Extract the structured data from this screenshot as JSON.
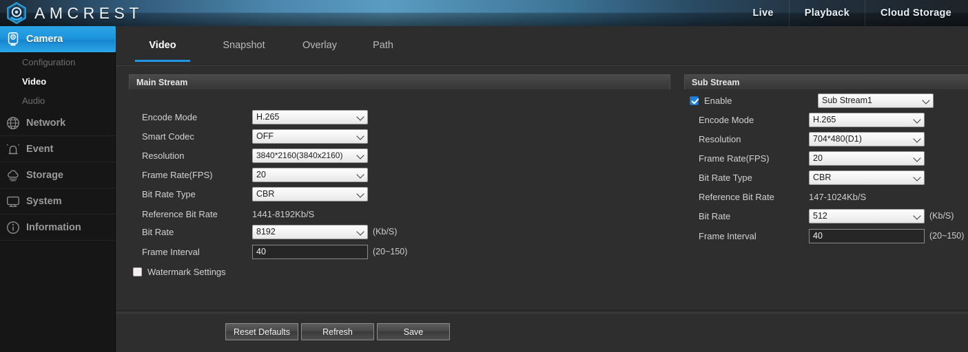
{
  "header": {
    "brand": "AMCREST",
    "logo_icon": "amcrest-hex-lens-logo",
    "nav": [
      {
        "label": "Live"
      },
      {
        "label": "Playback"
      },
      {
        "label": "Cloud Storage"
      }
    ],
    "accent_color": "#2196e6",
    "gradient_from": "#5b9cc2",
    "gradient_to": "#1d2329"
  },
  "sidebar": {
    "groups": [
      {
        "label": "Camera",
        "icon": "camera-icon",
        "active": true,
        "children": [
          {
            "label": "Configuration",
            "selected": false
          },
          {
            "label": "Video",
            "selected": true
          },
          {
            "label": "Audio",
            "selected": false
          }
        ]
      },
      {
        "label": "Network",
        "icon": "network-globe-icon",
        "active": false,
        "children": []
      },
      {
        "label": "Event",
        "icon": "event-bell-icon",
        "active": false,
        "children": []
      },
      {
        "label": "Storage",
        "icon": "storage-cloud-icon",
        "active": false,
        "children": []
      },
      {
        "label": "System",
        "icon": "system-monitor-icon",
        "active": false,
        "children": []
      },
      {
        "label": "Information",
        "icon": "information-icon",
        "active": false,
        "children": []
      }
    ]
  },
  "tabs": [
    {
      "label": "Video",
      "active": true
    },
    {
      "label": "Snapshot",
      "active": false
    },
    {
      "label": "Overlay",
      "active": false
    },
    {
      "label": "Path",
      "active": false
    }
  ],
  "main_stream": {
    "title": "Main Stream",
    "encode_mode": {
      "label": "Encode Mode",
      "value": "H.265"
    },
    "smart_codec": {
      "label": "Smart Codec",
      "value": "OFF"
    },
    "resolution": {
      "label": "Resolution",
      "value": "3840*2160(3840x2160)"
    },
    "frame_rate": {
      "label": "Frame Rate(FPS)",
      "value": "20"
    },
    "bit_rate_type": {
      "label": "Bit Rate Type",
      "value": "CBR"
    },
    "reference_bit_rate": {
      "label": "Reference Bit Rate",
      "value": "1441-8192Kb/S"
    },
    "bit_rate": {
      "label": "Bit Rate",
      "value": "8192",
      "units": "(Kb/S)"
    },
    "frame_interval": {
      "label": "Frame Interval",
      "value": "40",
      "units": "(20~150)"
    },
    "watermark": {
      "label": "Watermark Settings",
      "checked": false
    }
  },
  "sub_stream": {
    "title": "Sub Stream",
    "enable": {
      "label": "Enable",
      "checked": true,
      "value": "Sub Stream1"
    },
    "encode_mode": {
      "label": "Encode Mode",
      "value": "H.265"
    },
    "resolution": {
      "label": "Resolution",
      "value": "704*480(D1)"
    },
    "frame_rate": {
      "label": "Frame Rate(FPS)",
      "value": "20"
    },
    "bit_rate_type": {
      "label": "Bit Rate Type",
      "value": "CBR"
    },
    "reference_bit_rate": {
      "label": "Reference Bit Rate",
      "value": "147-1024Kb/S"
    },
    "bit_rate": {
      "label": "Bit Rate",
      "value": "512",
      "units": "(Kb/S)"
    },
    "frame_interval": {
      "label": "Frame Interval",
      "value": "40",
      "units": "(20~150)"
    }
  },
  "footer": {
    "reset_label": "Reset Defaults",
    "refresh_label": "Refresh",
    "save_label": "Save"
  }
}
